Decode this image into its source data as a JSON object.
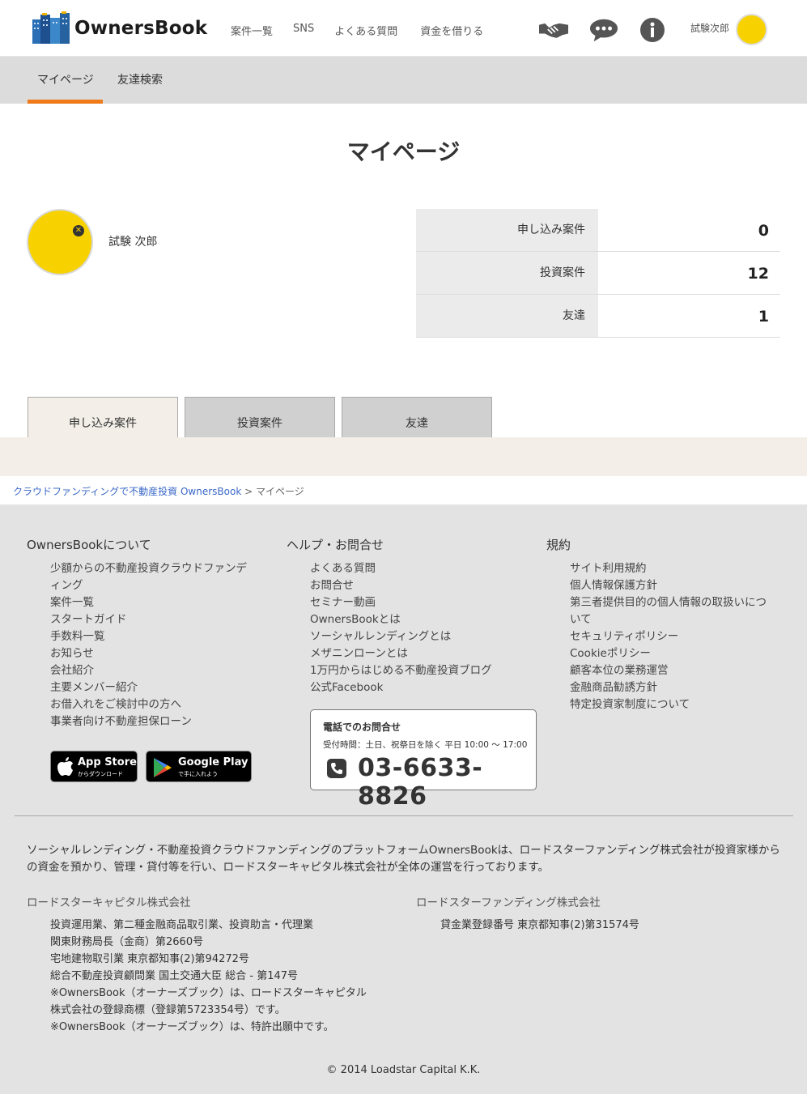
{
  "header": {
    "logo_text": "OwnersBook",
    "nav": [
      "案件一覧",
      "SNS",
      "よくある質問",
      "資金を借りる"
    ],
    "icons": [
      "handshake-icon",
      "chat-icon",
      "info-icon"
    ],
    "user_name": "試験次郎"
  },
  "subnav": {
    "tabs": [
      "マイページ",
      "友達検索"
    ],
    "active": "マイページ"
  },
  "page_title": "マイページ",
  "profile": {
    "name": "試験 次郎"
  },
  "stats": [
    {
      "label": "申し込み案件",
      "value": "0"
    },
    {
      "label": "投資案件",
      "value": "12"
    },
    {
      "label": "友達",
      "value": "1"
    }
  ],
  "content_tabs": [
    "申し込み案件",
    "投資案件",
    "友達"
  ],
  "breadcrumb": {
    "link": "クラウドファンディングで不動産投資 OwnersBook",
    "separator": ">",
    "current": "マイページ"
  },
  "footer": {
    "col1": {
      "title": "OwnersBookについて",
      "items": [
        "少額からの不動産投資クラウドファンデ",
        "ィング",
        "案件一覧",
        "スタートガイド",
        "手数料一覧",
        "お知らせ",
        "会社紹介",
        "主要メンバー紹介",
        "お借入れをご検討中の方へ",
        "事業者向け不動産担保ローン"
      ]
    },
    "col2": {
      "title": "ヘルプ・お問合せ",
      "items": [
        "よくある質問",
        "お問合せ",
        "セミナー動画",
        "OwnersBookとは",
        "ソーシャルレンディングとは",
        "メザニンローンとは",
        "1万円からはじめる不動産投資ブログ",
        "公式Facebook"
      ]
    },
    "col3": {
      "title": "規約",
      "items": [
        "サイト利用規約",
        "個人情報保護方針",
        "第三者提供目的の個人情報の取扱いにつ",
        "いて",
        "セキュリティポリシー",
        "Cookieポリシー",
        "顧客本位の業務運営",
        "金融商品勧誘方針",
        "特定投資家制度について"
      ]
    },
    "app_store": {
      "big": "App Store",
      "small": "からダウンロード"
    },
    "google_play": {
      "big": "Google Play",
      "small": "で手に入れよう"
    },
    "phone": {
      "title": "電話でのお問合せ",
      "hours": "受付時間：土日、祝祭日を除く 平日 10:00 〜 17:00",
      "number": "03-6633-8826"
    },
    "description": "ソーシャルレンディング・不動産投資クラウドファンディングのプラットフォームOwnersBookは、ロードスターファンディング株式会社が投資家様からの資金を預かり、管理・貸付等を行い、ロードスターキャピタル株式会社が全体の運営を行っております。",
    "company1": {
      "name": "ロードスターキャピタル株式会社",
      "lines": [
        "投資運用業、第二種金融商品取引業、投資助言・代理業",
        "関東財務局長（金商）第2660号",
        "宅地建物取引業 東京都知事(2)第94272号",
        "総合不動産投資顧問業 国土交通大臣 総合 - 第147号",
        "※OwnersBook（オーナーズブック）は、ロードスターキャピタル",
        "株式会社の登録商標（登録第5723354号）です。",
        "※OwnersBook（オーナーズブック）は、特許出願中です。"
      ]
    },
    "company2": {
      "name": "ロードスターファンディング株式会社",
      "lines": [
        "貸金業登録番号 東京都知事(2)第31574号"
      ]
    },
    "copyright": "© 2014 Loadstar Capital K.K."
  }
}
